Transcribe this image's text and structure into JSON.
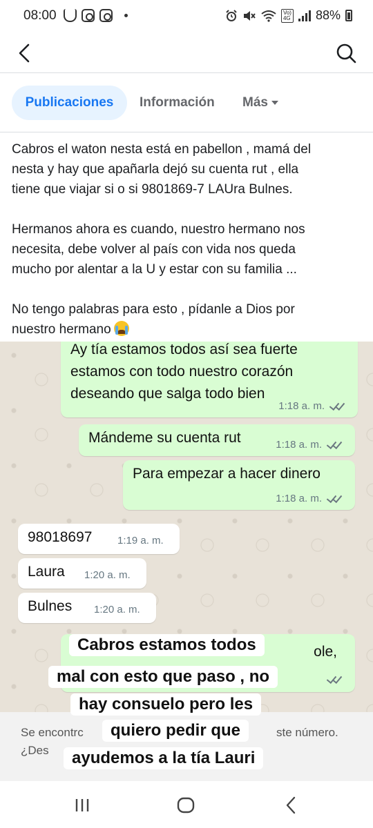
{
  "status_bar": {
    "time": "08:00",
    "battery": "88%",
    "icons": [
      "cup-icon",
      "instagram-icon",
      "instagram-icon",
      "alarm-icon",
      "mute-icon",
      "wifi-icon",
      "volte-icon",
      "signal-icon",
      "battery-icon"
    ],
    "volte_top": "Vo)",
    "volte_bottom": "4G"
  },
  "app_bar": {
    "back_icon": "back-arrow-icon",
    "search_icon": "search-icon"
  },
  "tabs": [
    {
      "label": "Publicaciones",
      "active": true
    },
    {
      "label": "Información",
      "active": false
    },
    {
      "label": "Más",
      "active": false
    }
  ],
  "post": {
    "paragraph1": [
      "Cabros el waton nesta está en pabellon , mamá del",
      "nesta y hay que apañarla  dejó su cuenta rut , ella",
      "tiene que  viajar si o si  9801869-7 LAUra Bulnes."
    ],
    "paragraph2": [
      "Hermanos ahora es cuando, nuestro hermano nos",
      "necesita, debe volver al país con vida nos queda",
      "mucho por alentar a la U y estar con su familia ..."
    ],
    "paragraph3": [
      "No tengo palabras para esto , pídanle a Dios por",
      "nuestro hermano"
    ],
    "emoji": "crying-face-emoji"
  },
  "chat": {
    "messages": [
      {
        "dir": "out",
        "lines": [
          "Ay tía estamos todos así sea fuerte",
          "estamos con todo nuestro corazón",
          "deseando que salga todo bien"
        ],
        "time": "1:18 a. m."
      },
      {
        "dir": "out",
        "lines": [
          "Mándeme su cuenta rut"
        ],
        "time": "1:18 a. m."
      },
      {
        "dir": "out",
        "lines": [
          "Para empezar a hacer dinero"
        ],
        "time": "1:18 a. m."
      },
      {
        "dir": "in",
        "lines": [
          "98018697"
        ],
        "time": "1:19 a. m."
      },
      {
        "dir": "in",
        "lines": [
          "Laura"
        ],
        "time": "1:20 a. m."
      },
      {
        "dir": "in",
        "lines": [
          "Bulnes"
        ],
        "time": "1:20 a. m."
      }
    ],
    "partial_bubble_text": "ole,",
    "banner_left": "Se encontrc",
    "banner_right": "ste número.",
    "banner_left2": "¿Des",
    "sticker_lines": [
      "Cabros estamos todos",
      "mal con esto que paso , no",
      "hay consuelo pero les",
      "quiero pedir que",
      "ayudemos a la tía Lauri"
    ]
  },
  "nav_bar": {
    "icons": [
      "recent-apps-icon",
      "home-icon",
      "back-icon"
    ]
  }
}
